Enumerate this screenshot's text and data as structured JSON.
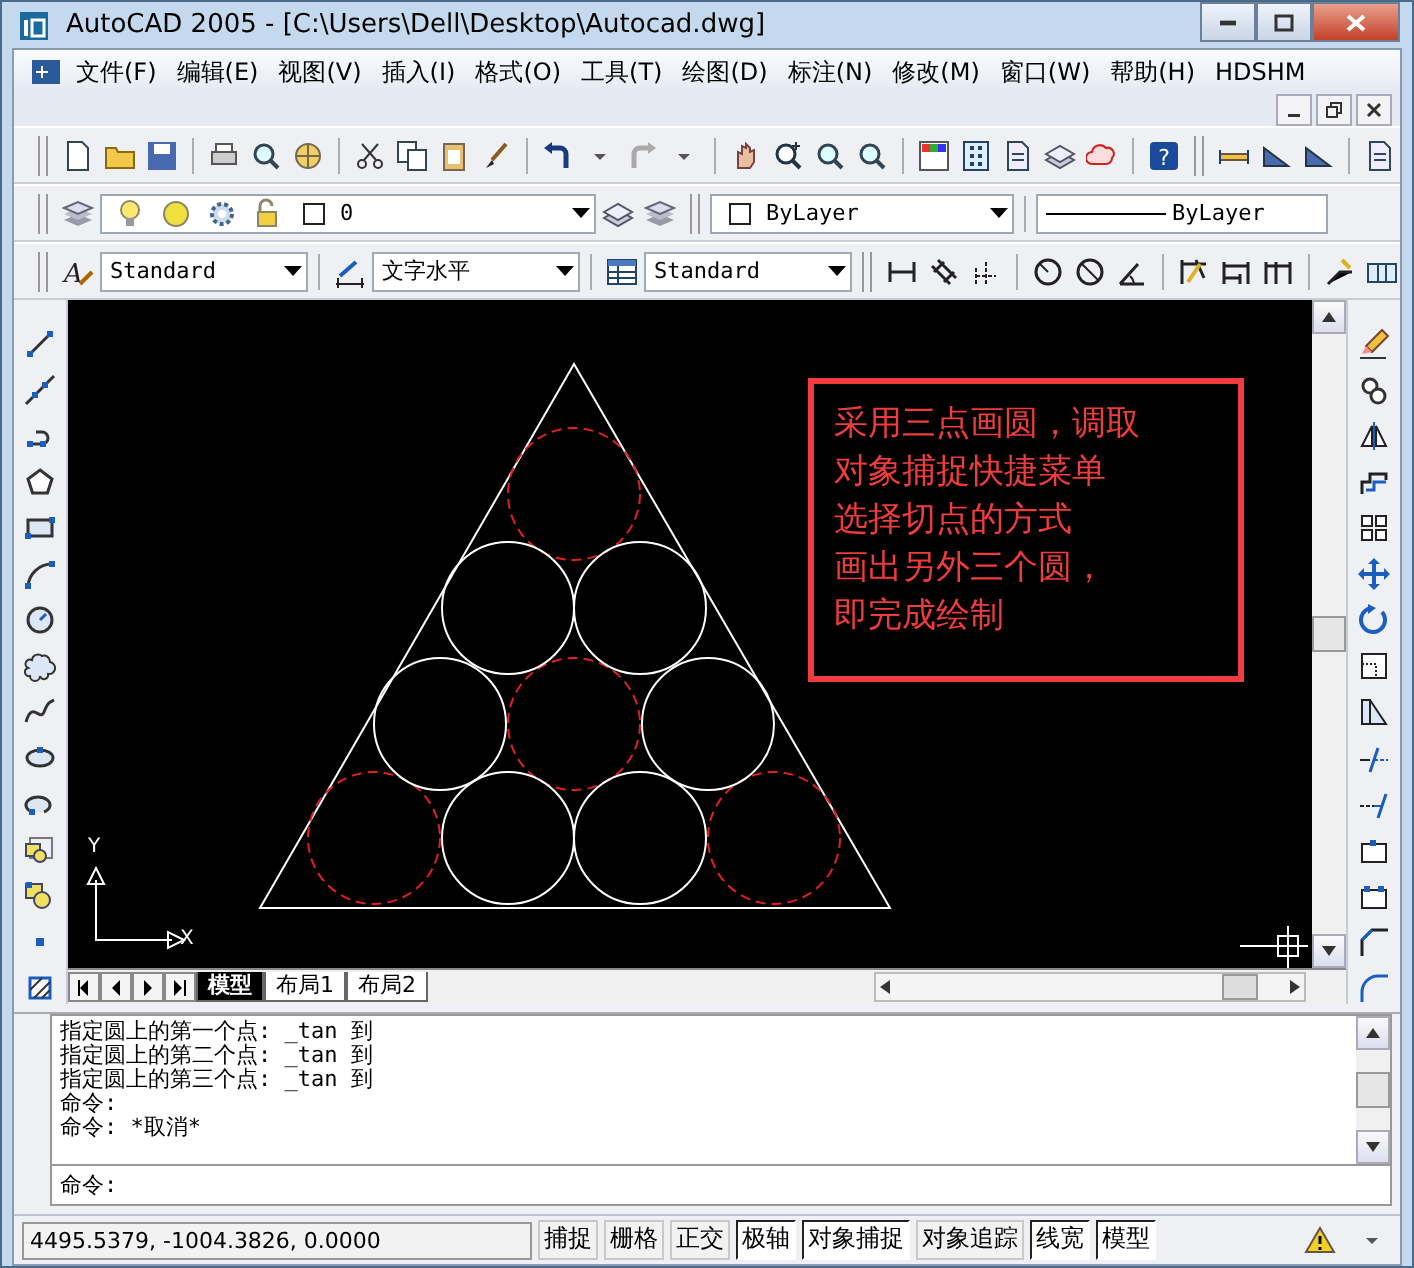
{
  "window": {
    "title": "AutoCAD 2005 - [C:\\Users\\Dell\\Desktop\\Autocad.dwg]"
  },
  "menu": [
    "文件(F)",
    "编辑(E)",
    "视图(V)",
    "插入(I)",
    "格式(O)",
    "工具(T)",
    "绘图(D)",
    "标注(N)",
    "修改(M)",
    "窗口(W)",
    "帮助(H)",
    "HDSHM"
  ],
  "standard_toolbar": {
    "help_glyph": "?"
  },
  "layers_toolbar": {
    "layer": "0",
    "color_dropdown": "ByLayer",
    "linetype": "ByLayer"
  },
  "styles_toolbar": {
    "text_style_glyph": "A",
    "text_style": "Standard",
    "dim_style": "文字水平",
    "table_style": "Standard"
  },
  "drawing": {
    "ucs_y": "Y",
    "ucs_x": "X",
    "note_lines": [
      "采用三点画圆，调取",
      "对象捕捉快捷菜单",
      "选择切点的方式",
      "画出另外三个圆，",
      "即完成绘制"
    ]
  },
  "layout_tabs": [
    {
      "label": "模型",
      "selected": true
    },
    {
      "label": "布局1",
      "selected": false
    },
    {
      "label": "布局2",
      "selected": false
    }
  ],
  "command_history": [
    "指定圆上的第一个点: _tan 到",
    "指定圆上的第二个点: _tan 到",
    "指定圆上的第三个点: _tan 到",
    "命令:",
    "命令: *取消*"
  ],
  "command_prompt": "命令:",
  "status_bar": {
    "coordinates": "4495.5379, -1004.3826, 0.0000",
    "toggles": [
      {
        "label": "捕捉",
        "on": false
      },
      {
        "label": "栅格",
        "on": false
      },
      {
        "label": "正交",
        "on": false
      },
      {
        "label": "极轴",
        "on": true
      },
      {
        "label": "对象捕捉",
        "on": true
      },
      {
        "label": "对象追踪",
        "on": false
      },
      {
        "label": "线宽",
        "on": true
      },
      {
        "label": "模型",
        "on": true
      }
    ]
  }
}
